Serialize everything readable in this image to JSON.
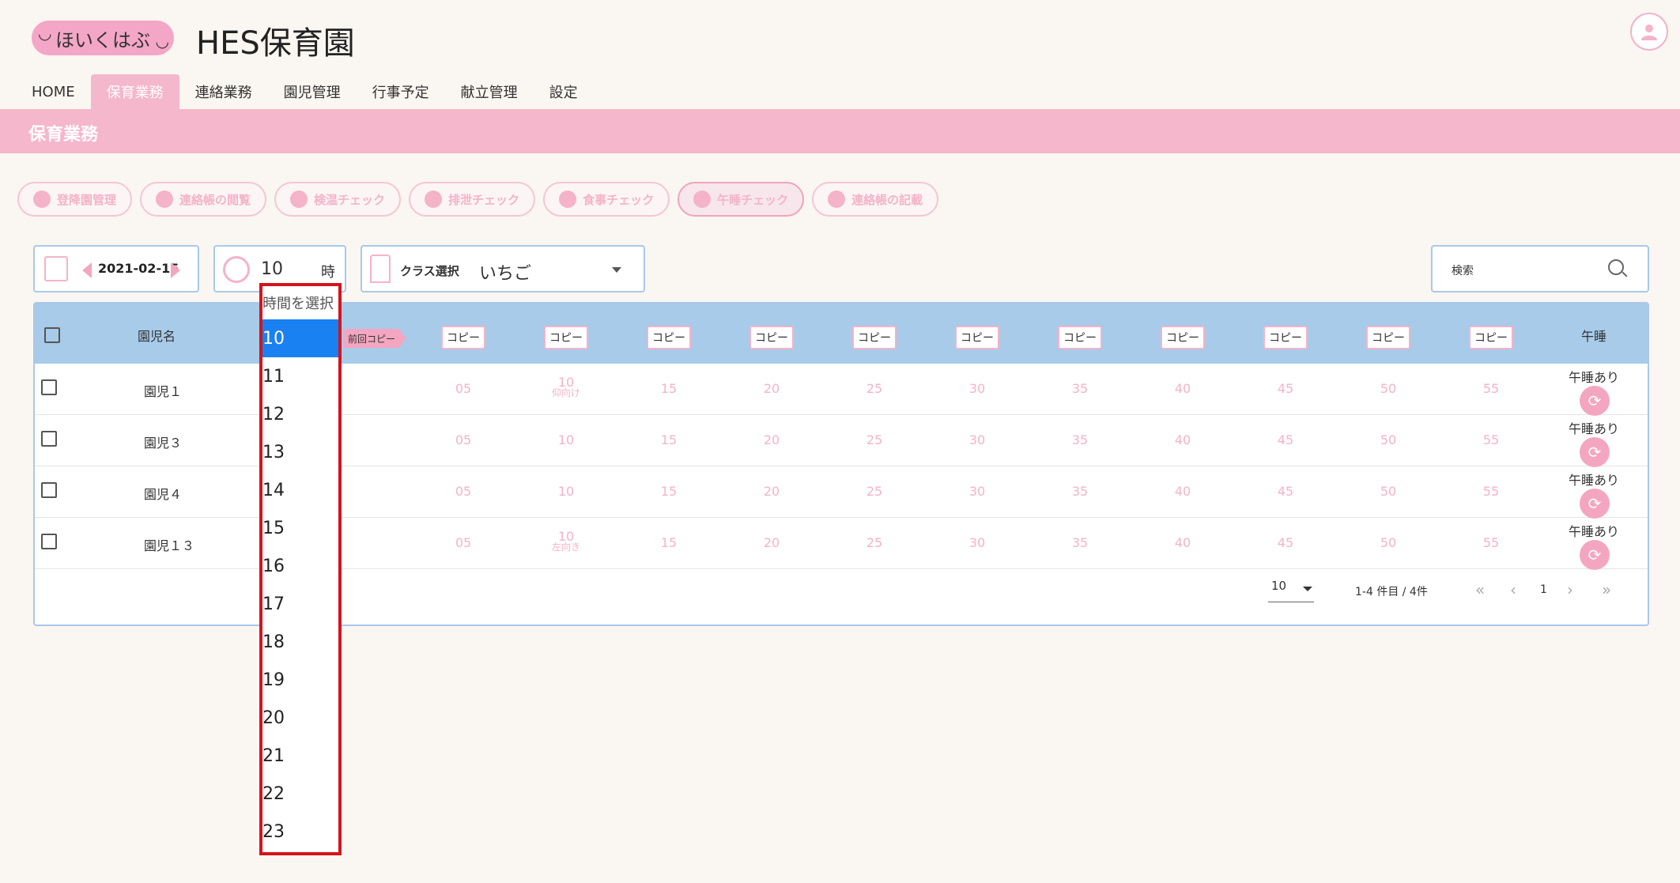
{
  "header": {
    "logo_text": "ほいくはぶ",
    "site_title": "HES保育園"
  },
  "nav": [
    "HOME",
    "保育業務",
    "連絡業務",
    "園児管理",
    "行事予定",
    "献立管理",
    "設定"
  ],
  "band_title": "保育業務",
  "action_buttons": [
    "登降園管理",
    "連絡帳の閲覧",
    "検温チェック",
    "排泄チェック",
    "食事チェック",
    "午睡チェック",
    "連絡帳の記載"
  ],
  "filters": {
    "date": "2021-02-15",
    "hour_value": "10",
    "hour_unit": "時",
    "class_label": "クラス選択",
    "class_value": "いちご",
    "search_label": "検索"
  },
  "table": {
    "header_name": "園児名",
    "header_nap": "午睡",
    "prev_copy": "前回コピー",
    "copy_label": "コピー",
    "minutes": [
      "05",
      "10",
      "15",
      "20",
      "25",
      "30",
      "35",
      "40",
      "45",
      "50",
      "55"
    ],
    "rows": [
      {
        "name": "園児１",
        "nap": "午睡あり",
        "note_10": "仰向け"
      },
      {
        "name": "園児３",
        "nap": "午睡あり",
        "note_10": ""
      },
      {
        "name": "園児４",
        "nap": "午睡あり",
        "note_10": ""
      },
      {
        "name": "園児１３",
        "nap": "午睡あり",
        "note_10": "左向き"
      }
    ]
  },
  "pagination": {
    "per_page": "10",
    "range_text": "1-4 件目 / 4件",
    "page": "1"
  },
  "hour_dropdown": {
    "header": "時間を選択",
    "options": [
      "10",
      "11",
      "12",
      "13",
      "14",
      "15",
      "16",
      "17",
      "18",
      "19",
      "20",
      "21",
      "22",
      "23"
    ],
    "selected": "10"
  },
  "colors": {
    "accent_pink": "#f4b7cb",
    "header_blue": "#a7cbe9",
    "selected_blue": "#1a81f2",
    "highlight_red": "#d4141c"
  }
}
